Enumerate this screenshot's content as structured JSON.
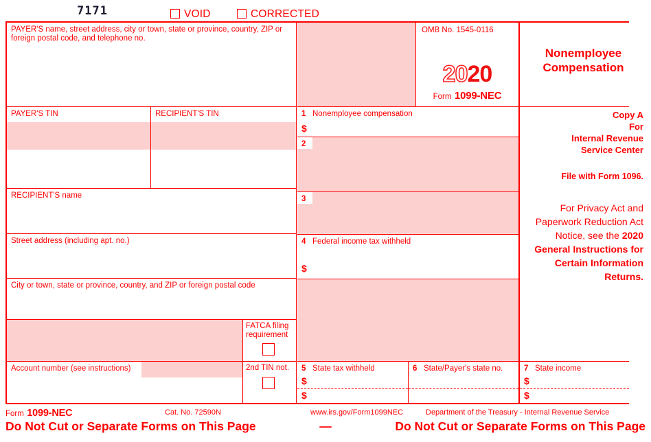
{
  "document": {
    "form_code": "7171",
    "title_line1": "Nonemployee",
    "title_line2": "Compensation",
    "colors": {
      "ink": "#ff0000",
      "data_fill": "#fdd0d0",
      "code_ink": "#1a1a2e"
    }
  },
  "topbar": {
    "void_label": "VOID",
    "corrected_label": "CORRECTED"
  },
  "omb": {
    "number_label": "OMB No. 1545-0116",
    "year_hollow": "20",
    "year_solid": "20",
    "form_prefix": "Form",
    "form_number": "1099-NEC"
  },
  "payer": {
    "address_label": "PAYER'S name, street address, city or town, state or province, country, ZIP or foreign postal code, and telephone no.",
    "payer_tin_label": "PAYER'S TIN",
    "recipient_tin_label": "RECIPIENT'S TIN",
    "payer_tin_value": "",
    "recipient_tin_value": "",
    "address_value": ""
  },
  "recipient": {
    "name_label": "RECIPIENT'S name",
    "name_value": "",
    "street_label": "Street address (including apt. no.)",
    "street_value": "",
    "city_label": "City or town, state or province, country, and ZIP or foreign postal code",
    "city_value": "",
    "fatca_label_line1": "FATCA filing",
    "fatca_label_line2": "requirement",
    "fatca_checked": false,
    "account_number_label": "Account number (see instructions)",
    "account_number_value": "",
    "second_tin_label": "2nd TIN not.",
    "second_tin_checked": false
  },
  "boxes": [
    {
      "number": "1",
      "label": "Nonemployee compensation",
      "value": "",
      "currency": "$",
      "filled": false
    },
    {
      "number": "2",
      "label": "",
      "value": "",
      "currency": "",
      "filled": true
    },
    {
      "number": "3",
      "label": "",
      "value": "",
      "currency": "",
      "filled": true
    },
    {
      "number": "4",
      "label": "Federal income tax withheld",
      "value": "",
      "currency": "$",
      "filled": false
    },
    {
      "number": "5",
      "label": "State tax withheld",
      "value_row1": "",
      "value_row2": "",
      "currency": "$",
      "filled": false
    },
    {
      "number": "6",
      "label": "State/Payer's state no.",
      "value_row1": "",
      "value_row2": "",
      "currency": "",
      "filled": false
    },
    {
      "number": "7",
      "label": "State income",
      "value_row1": "",
      "value_row2": "",
      "currency": "$",
      "filled": false
    }
  ],
  "copy_block": {
    "line1": "Copy A",
    "line2": "For",
    "line3": "Internal Revenue",
    "line4": "Service Center",
    "file_with": "File with Form 1096."
  },
  "privacy": {
    "normal_text": "For Privacy Act and Paperwork Reduction Act Notice, see the",
    "bold_text": "2020 General Instructions for Certain Information Returns."
  },
  "footer": {
    "form_prefix": "Form",
    "form_number": "1099-NEC",
    "catalog": "Cat. No. 72590N",
    "url": "www.irs.gov/Form1099NEC",
    "department": "Department of the Treasury - Internal Revenue Service",
    "notice_left": "Do Not Cut or Separate Forms on This Page",
    "notice_dash": "—",
    "notice_right": "Do Not Cut or Separate Forms on This Page"
  }
}
